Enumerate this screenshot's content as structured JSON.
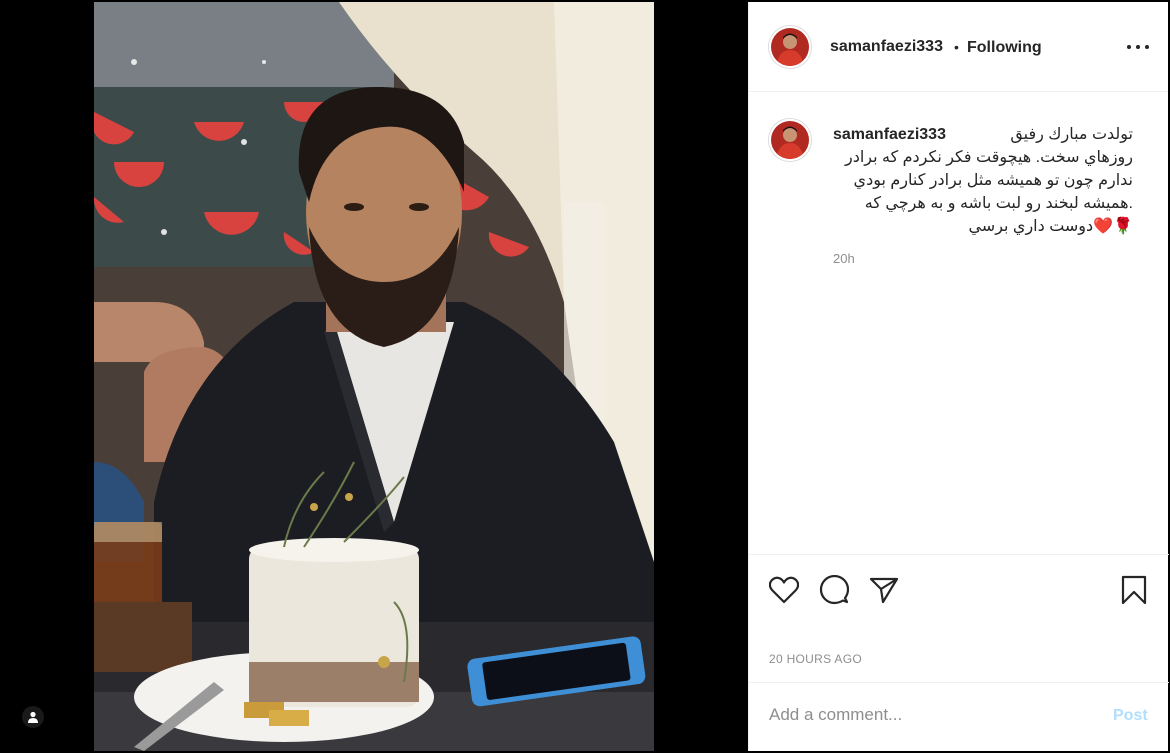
{
  "post": {
    "username": "samanfaezi333",
    "separator": "•",
    "follow_status": "Following",
    "more_icon": "more-options-icon",
    "caption": {
      "username": "samanfaezi333",
      "lines": [
        "تولدت مبارك رفيق",
        "روزهاي سخت. هيچوقت فكر نكردم كه برادر",
        "ندارم چون تو هميشه مثل برادر كنارم بودي",
        ".هميشه لبخند رو لبت باشه و به هرچي كه",
        "🌹❤️دوست داري برسي"
      ],
      "relative_time": "20h"
    },
    "actions": {
      "like_icon": "heart-icon",
      "comment_icon": "comment-icon",
      "share_icon": "paper-plane-icon",
      "save_icon": "bookmark-icon"
    },
    "timestamp": "20 HOURS AGO",
    "comment": {
      "placeholder": "Add a comment...",
      "post_label": "Post"
    }
  },
  "media": {
    "tag_icon": "user-tag-icon"
  }
}
